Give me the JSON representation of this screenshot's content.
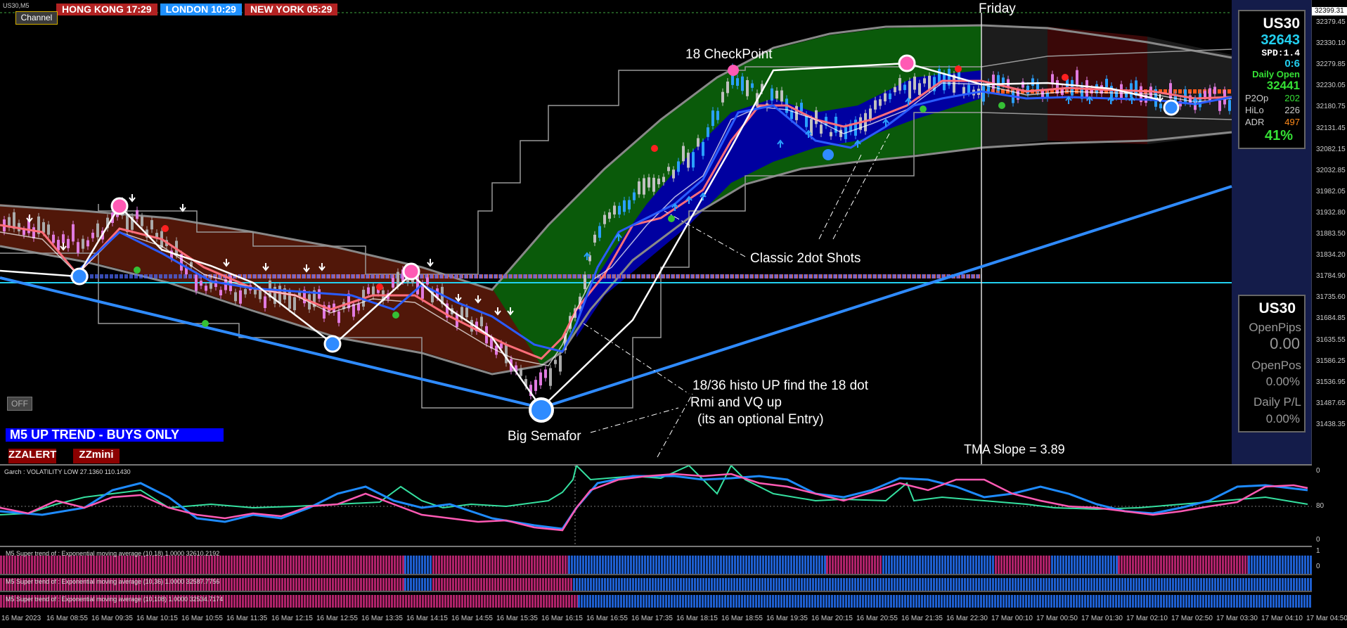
{
  "symbol_tab": "US30,M5",
  "sessions": [
    {
      "label": "HONG KONG  17:29",
      "color": "#b22222"
    },
    {
      "label": "LONDON  10:29",
      "color": "#1e90ff"
    },
    {
      "label": "NEW YORK  05:29",
      "color": "#b22222"
    }
  ],
  "channel_button": "Channel",
  "off_button": "OFF",
  "trend_banner": "M5 UP TREND - BUYS ONLY",
  "zz_buttons": [
    "ZZALERT",
    "ZZmini"
  ],
  "annotations": {
    "friday": "Friday",
    "checkpoint": "18 CheckPoint",
    "two_dot": "Classic 2dot Shots",
    "histo": "18/36 histo UP find the 18 dot",
    "rmi": "Rmi and VQ up",
    "optional": "(its an optional Entry)",
    "semafor": "Big Semafor",
    "tma": "TMA Slope = 3.89"
  },
  "info_box": {
    "symbol": "US30",
    "price": "32643",
    "spread": "SPD:1.4",
    "time": "0:6",
    "daily_open_label": "Daily Open",
    "daily_open": "32441",
    "p2op_label": "P2Op",
    "p2op": "202",
    "hilo_label": "HiLo",
    "hilo": "226",
    "adr_label": "ADR",
    "adr": "497",
    "percent": "41%"
  },
  "positions_box": {
    "symbol": "US30",
    "open_pips_label": "OpenPips",
    "open_pips": "0.00",
    "open_pos_label": "OpenPos",
    "open_pos": "0.00%",
    "daily_pl_label": "Daily P/L",
    "daily_pl": "0.00%"
  },
  "price_axis": [
    "32399.31",
    "32379.45",
    "32330.10",
    "32279.85",
    "32230.05",
    "32180.75",
    "32131.45",
    "32082.15",
    "32032.85",
    "31982.05",
    "31932.80",
    "31883.50",
    "31834.20",
    "31784.90",
    "31735.60",
    "31684.85",
    "31635.55",
    "31586.25",
    "31536.95",
    "31487.65",
    "31438.35"
  ],
  "garch_label": "Garch : VOLATILITY LOW 27.1360 110.1430",
  "garch_axis": [
    "0",
    "80",
    "0"
  ],
  "supertrend_labels": [
    "M5  Super trend of : Exponential moving average (10,18)  1.0000  32610.2192",
    "M5  Super trend of : Exponential moving average (10,36)  1.0000  32587.7756",
    "M5  Super trend of : Exponential moving average (10,108)  1.0000  32534.7174"
  ],
  "st_axis": [
    "1",
    "0"
  ],
  "time_axis": [
    "16 Mar 2023",
    "16 Mar 08:55",
    "16 Mar 09:35",
    "16 Mar 10:15",
    "16 Mar 10:55",
    "16 Mar 11:35",
    "16 Mar 12:15",
    "16 Mar 12:55",
    "16 Mar 13:35",
    "16 Mar 14:15",
    "16 Mar 14:55",
    "16 Mar 15:35",
    "16 Mar 16:15",
    "16 Mar 16:55",
    "16 Mar 17:35",
    "16 Mar 18:15",
    "16 Mar 18:55",
    "16 Mar 19:35",
    "16 Mar 20:15",
    "16 Mar 20:55",
    "16 Mar 21:35",
    "16 Mar 22:30",
    "17 Mar 00:10",
    "17 Mar 00:50",
    "17 Mar 01:30",
    "17 Mar 02:10",
    "17 Mar 02:50",
    "17 Mar 03:30",
    "17 Mar 04:10",
    "17 Mar 04:50"
  ],
  "colors": {
    "up_blue": "#1e5fd0",
    "down_pink": "#b0226a",
    "green_band": "#0a5a0a",
    "brown_band": "#5a1a0a",
    "navy_band": "#0000a0",
    "trend_line": "#2f8bff",
    "cyan_line": "#22d0f0"
  }
}
